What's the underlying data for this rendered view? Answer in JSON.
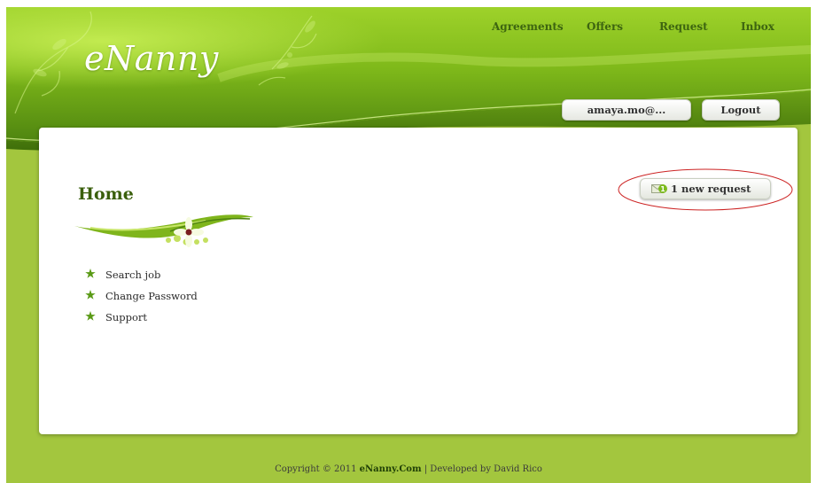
{
  "brand": {
    "logo_text": "eNanny"
  },
  "nav": {
    "agreements": "Agreements",
    "offers": "Offers",
    "request": "Request",
    "inbox": "Inbox"
  },
  "account": {
    "user_label": "amaya.mo@...",
    "logout_label": "Logout"
  },
  "main": {
    "title": "Home",
    "menu": [
      {
        "label": "Search job"
      },
      {
        "label": "Change Password"
      },
      {
        "label": "Support"
      }
    ],
    "notification": {
      "count": "1",
      "label": "1 new request"
    }
  },
  "footer": {
    "copyright": "Copyright © 2011",
    "site": "eNanny.Com",
    "separator": "|",
    "developer": "Developed by David Rico"
  },
  "icons": {
    "mail": "mail-icon",
    "bullet": "green-star-icon",
    "flourish": "floral-swoosh-icon"
  },
  "colors": {
    "page_bg": "#a3c63e",
    "header_dark": "#5b8e12",
    "header_light": "#8cc21e",
    "nav_text": "#3d6510",
    "title_text": "#3a5f0c",
    "highlight": "#cc2222"
  }
}
